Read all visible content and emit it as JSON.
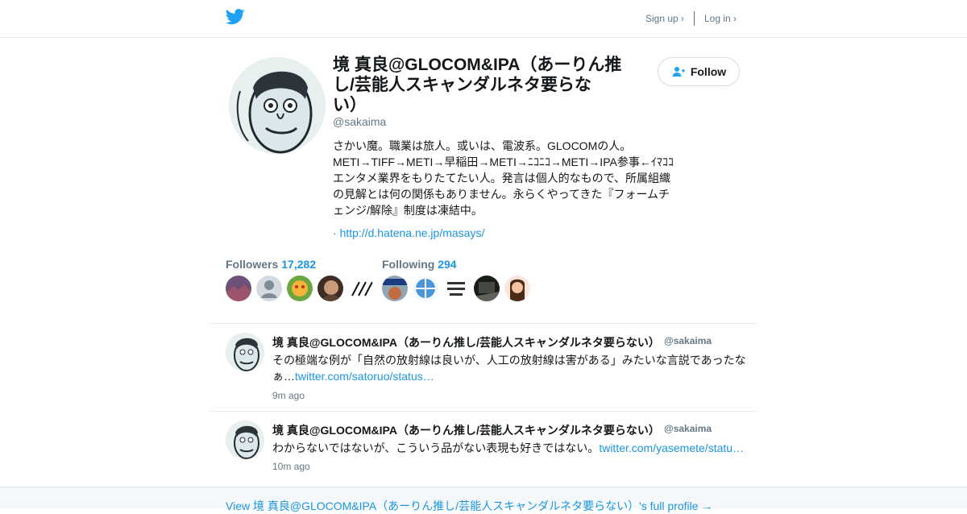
{
  "header": {
    "logo_icon": "bird-icon",
    "signup": "Sign up ›",
    "login": "Log in ›"
  },
  "profile": {
    "name": "境 真良@GLOCOM&IPA（あーりん推\nし/芸能人スキャンダルネタ要らな\nい）",
    "handle": "@sakaima",
    "bio": "さかい魔。職業は旅人。或いは、電波系。GLOCOMの人。METI→TIFF→METI→早稲田→METI→ﾆｺﾆｺ→METI→IPA参事←ｲﾏｺｺ エンタメ業界をもりたてたい人。発言は個人的なもので、所属組織の見解とは何の関係もありません。永らくやってきた『フォームチェンジ/解除』制度は凍結中。",
    "link_prefix": "·",
    "link": "http://d.hatena.ne.jp/masays/",
    "follow_label": "Follow",
    "follow_icon": "add-user-icon"
  },
  "stats": {
    "followers_label": "Followers",
    "followers_count": "17,282",
    "following_label": "Following",
    "following_count": "294"
  },
  "tweets": [
    {
      "author": "境 真良@GLOCOM&IPA（あーりん推し/芸能人スキャンダルネタ要らない）",
      "handle": "@sakaima",
      "text": "その極端な例が「自然の放射線は良いが、人工の放射線は害がある」みたいな言説であったなぁ…",
      "link": "twitter.com/satoruo/status…",
      "time": "9m ago"
    },
    {
      "author": "境 真良@GLOCOM&IPA（あーりん推し/芸能人スキャンダルネタ要らない）",
      "handle": "@sakaima",
      "text": "わからないではないが、こういう品がない表現も好きではない。",
      "link": "twitter.com/yasemete/statu…",
      "time": "10m ago"
    }
  ],
  "footer": {
    "full_profile_link": "View 境 真良@GLOCOM&IPA（あーりん推し/芸能人スキャンダルネタ要らない）'s full profile →"
  },
  "colors": {
    "brand": "#1da1f2",
    "link": "#1b95e0",
    "muted": "#657786"
  }
}
